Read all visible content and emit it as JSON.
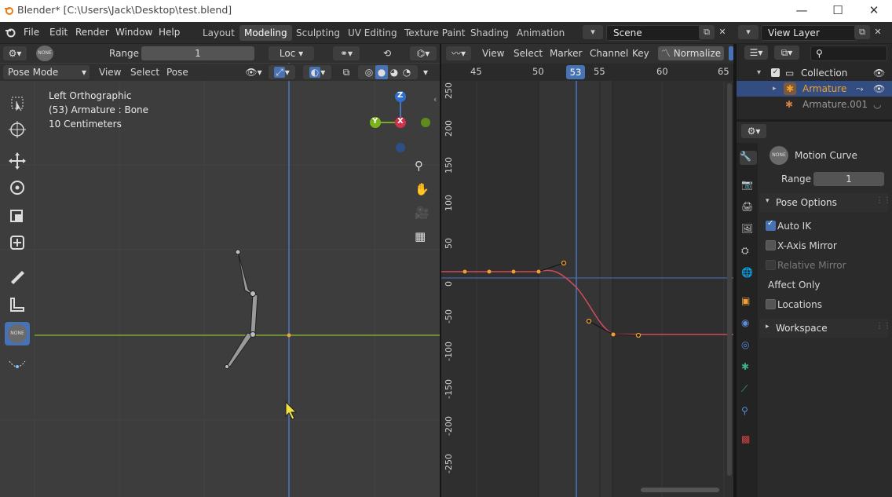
{
  "titlebar": {
    "title": "Blender* [C:\\Users\\Jack\\Desktop\\test.blend]",
    "min": "—",
    "max": "☐",
    "close": "✕"
  },
  "menus": [
    "File",
    "Edit",
    "Render",
    "Window",
    "Help"
  ],
  "workspaces": [
    "Layout",
    "Modeling",
    "Sculpting",
    "UV Editing",
    "Texture Paint",
    "Shading",
    "Animation"
  ],
  "active_workspace": "Modeling",
  "scene": {
    "label": "Scene"
  },
  "view_layer": {
    "label": "View Layer"
  },
  "viewport": {
    "header1": {
      "range_label": "Range",
      "range_value": "1",
      "transform_label": "Loc",
      "none_badge": "NONE"
    },
    "header2": {
      "mode": "Pose Mode",
      "view": "View",
      "select": "Select",
      "pose": "Pose"
    },
    "overlay": {
      "line1": "Left Orthographic",
      "line2": "(53) Armature : Bone",
      "line3": "10 Centimeters"
    },
    "gizmo": {
      "z": "Z",
      "y": "Y",
      "x": "X"
    },
    "tool_none_badge": "NONE"
  },
  "graph_editor": {
    "menus": {
      "view": "View",
      "select": "Select",
      "marker": "Marker",
      "channel": "Channel",
      "key": "Key"
    },
    "normalize": "Normalize",
    "ruler": [
      "45",
      "50",
      "55",
      "60",
      "65"
    ],
    "current_frame": "53",
    "y_ticks": [
      "250",
      "200",
      "150",
      "100",
      "50",
      "0",
      "-50",
      "-100",
      "-150",
      "-200",
      "-250"
    ]
  },
  "outliner": {
    "collection": "Collection",
    "armature": "Armature",
    "armature2": "Armature.001"
  },
  "properties": {
    "header_title": "Motion Curve",
    "none_badge": "NONE",
    "range_label": "Range",
    "range_value": "1",
    "pose_options": "Pose Options",
    "auto_ik": "Auto IK",
    "x_axis_mirror": "X-Axis Mirror",
    "relative_mirror": "Relative Mirror",
    "affect_only": "Affect Only",
    "locations": "Locations",
    "workspace": "Workspace"
  },
  "colors": {
    "accent": "#4772b3",
    "curve": "#d04a5c",
    "key": "#f0a030",
    "green_axis": "#7ea82e",
    "blue_axis": "#4a74c0"
  }
}
